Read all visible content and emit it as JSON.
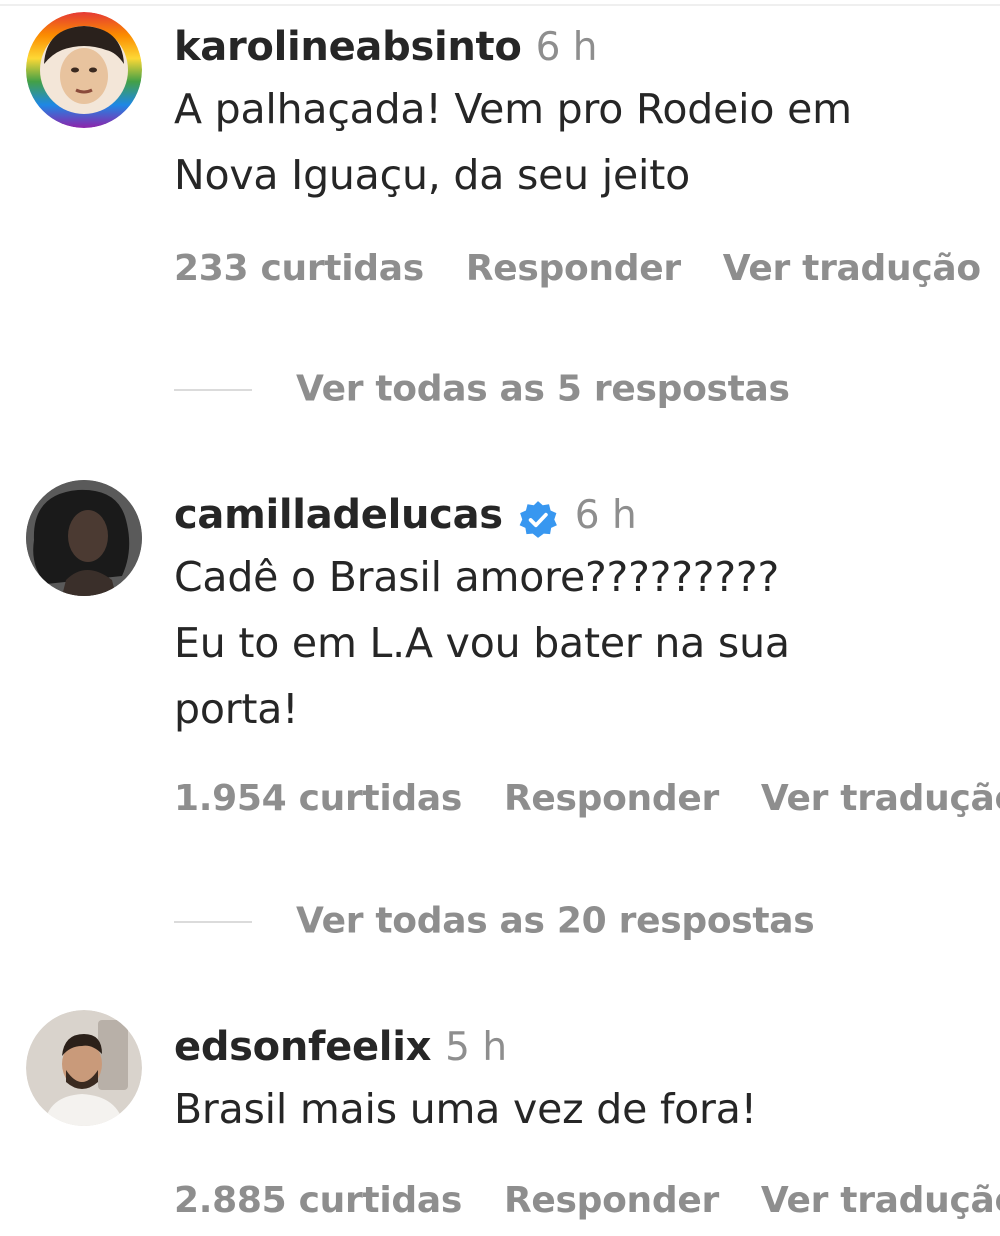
{
  "comments": [
    {
      "username": "karolineabsinto",
      "time": "6 h",
      "verified": false,
      "text_lines": [
        "A palhaçada! Vem pro Rodeio em",
        "Nova Iguaçu, da seu jeito"
      ],
      "likes": "233 curtidas",
      "reply_label": "Responder",
      "translate_label": "Ver tradução",
      "view_replies": "Ver todas as 5 respostas",
      "avatar_icon": "rainbow-ring-avatar-icon"
    },
    {
      "username": "camilladelucas",
      "time": "6 h",
      "verified": true,
      "text_lines": [
        "Cadê o Brasil amore?????????",
        "Eu to em L.A vou bater na sua",
        "porta!"
      ],
      "likes": "1.954 curtidas",
      "reply_label": "Responder",
      "translate_label": "Ver tradução",
      "view_replies": "Ver todas as 20 respostas",
      "avatar_icon": "profile-photo-avatar-icon"
    },
    {
      "username": "edsonfeelix",
      "time": "5 h",
      "verified": false,
      "text_lines": [
        "Brasil mais uma vez de fora!"
      ],
      "likes": "2.885 curtidas",
      "reply_label": "Responder",
      "translate_label": "Ver tradução",
      "avatar_icon": "profile-photo-avatar-icon"
    }
  ],
  "colors": {
    "text": "#262626",
    "secondary": "#8e8e8e",
    "verified_blue": "#3897f0",
    "divider": "#dbdbdb"
  }
}
